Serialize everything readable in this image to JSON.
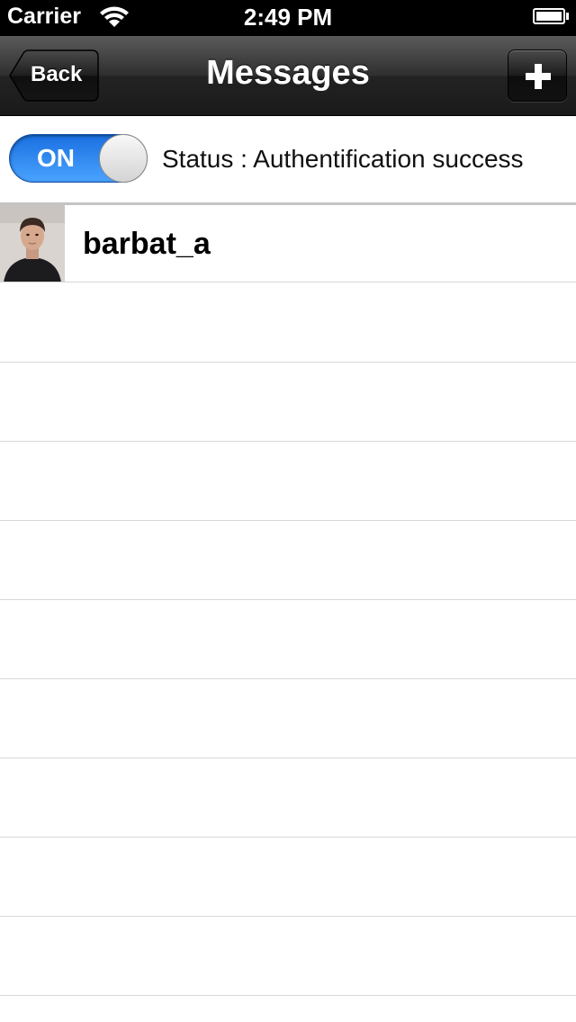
{
  "status_bar": {
    "carrier": "Carrier",
    "time": "2:49 PM"
  },
  "nav": {
    "title": "Messages",
    "back_label": "Back",
    "add_icon": "plus-icon"
  },
  "status_row": {
    "toggle_label": "ON",
    "toggle_on": true,
    "status_text": "Status : Authentification success"
  },
  "contacts": [
    {
      "name": "barbat_a",
      "avatar": "user-photo"
    }
  ],
  "colors": {
    "toggle_blue": "#2f86f0",
    "nav_dark": "#1a1a1a"
  }
}
